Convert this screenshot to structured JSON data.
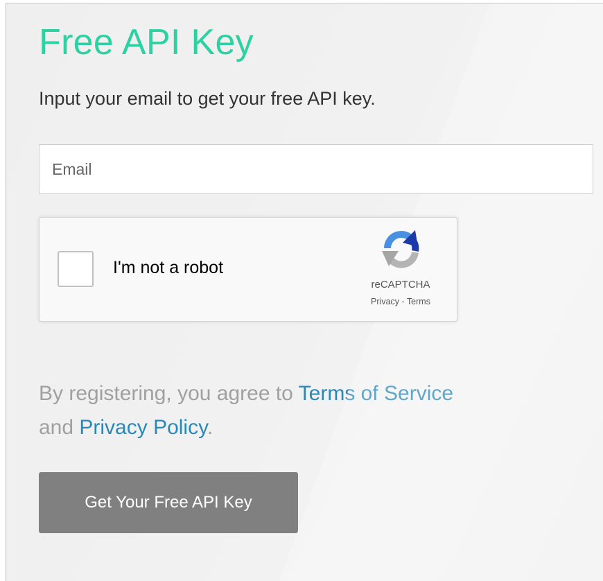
{
  "page": {
    "title": "Free API Key",
    "subtitle": "Input your email to get your free API key."
  },
  "form": {
    "email": {
      "placeholder": "Email",
      "value": ""
    },
    "recaptcha": {
      "label": "I'm not a robot",
      "checked": false,
      "brand": "reCAPTCHA",
      "privacy": "Privacy",
      "separator": " - ",
      "terms": "Terms",
      "icon": "recaptcha-logo-icon"
    },
    "agreement": {
      "prefix": "By registering, you agree to ",
      "terms_link": "Terms of Service",
      "middle": " and ",
      "privacy_link": "Privacy Policy",
      "suffix": "."
    },
    "submit_label": "Get Your Free API Key"
  },
  "colors": {
    "title": "#2ed1a2",
    "link": "#2a88b8",
    "button": "#808080",
    "muted_text": "#a0a0a0"
  }
}
